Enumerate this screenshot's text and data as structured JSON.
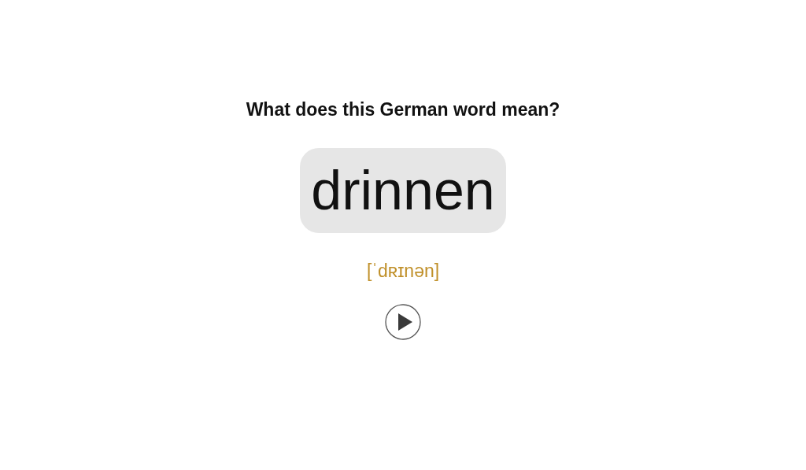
{
  "question": "What does this German word mean?",
  "word": "drinnen",
  "pronunciation": "[ˈdʀɪnən]"
}
